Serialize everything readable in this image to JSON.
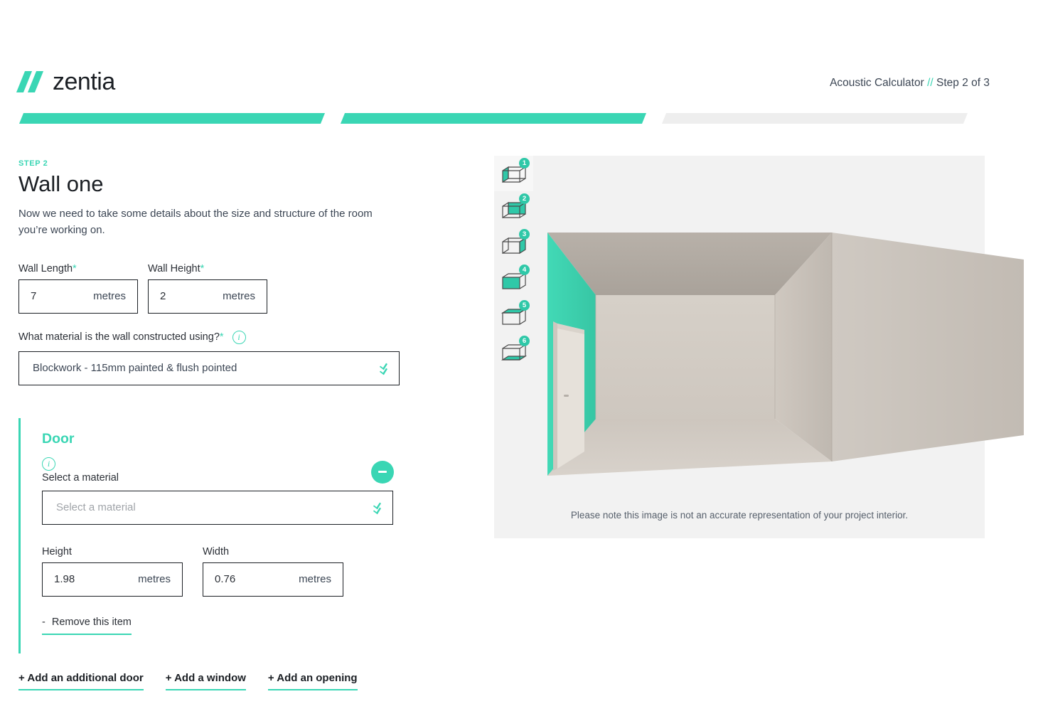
{
  "brand": {
    "name": "zentia",
    "accent": "#3ad6b4",
    "logo_icon": "zentia-slash-mark"
  },
  "header": {
    "app_title": "Acoustic Calculator",
    "separator": "//",
    "step_text": "Step 2 of 3"
  },
  "progress": {
    "total_steps": 3,
    "completed_steps": 2,
    "active_color": "#3ad6b4",
    "inactive_color": "#eeeeee"
  },
  "main": {
    "step_label": "STEP 2",
    "title": "Wall one",
    "intro": "Now we need to take some details about the size and structure of the room you’re working on.",
    "wall_length": {
      "label": "Wall Length",
      "required_mark": "*",
      "value": "7",
      "unit": "metres"
    },
    "wall_height": {
      "label": "Wall Height",
      "required_mark": "*",
      "value": "2",
      "unit": "metres"
    },
    "material_question": {
      "label": "What material is the wall constructed using?",
      "required_mark": "*",
      "info_icon": "info-icon",
      "selected": "Blockwork - 115mm painted & flush pointed"
    }
  },
  "door": {
    "title": "Door",
    "info_icon": "info-icon",
    "select_label": "Select a material",
    "material_placeholder": "Select a material",
    "material_value": "",
    "remove_button_icon": "minus-icon",
    "height": {
      "label": "Height",
      "value": "1.98",
      "unit": "metres"
    },
    "width": {
      "label": "Width",
      "value": "0.76",
      "unit": "metres"
    },
    "remove_link": {
      "prefix": "-",
      "label": "Remove this item"
    }
  },
  "add_actions": [
    {
      "label": "+ Add an additional door"
    },
    {
      "label": "+ Add a window"
    },
    {
      "label": "+ Add an opening"
    }
  ],
  "preview": {
    "note": "Please note this image is not an accurate representation of your project interior.",
    "selected_index": 1,
    "thumbnails": [
      {
        "number": "1",
        "name": "wall-one",
        "highlight": "left-wall"
      },
      {
        "number": "2",
        "name": "wall-two",
        "highlight": "back-wall"
      },
      {
        "number": "3",
        "name": "wall-three",
        "highlight": "right-wall"
      },
      {
        "number": "4",
        "name": "wall-four",
        "highlight": "front-wall"
      },
      {
        "number": "5",
        "name": "ceiling",
        "highlight": "ceiling"
      },
      {
        "number": "6",
        "name": "floor",
        "highlight": "floor"
      }
    ],
    "room_render": {
      "highlighted_surface": "left-wall",
      "highlight_color": "#3ecfae",
      "wall_color": "#cdc7c0",
      "has_door": true
    }
  }
}
